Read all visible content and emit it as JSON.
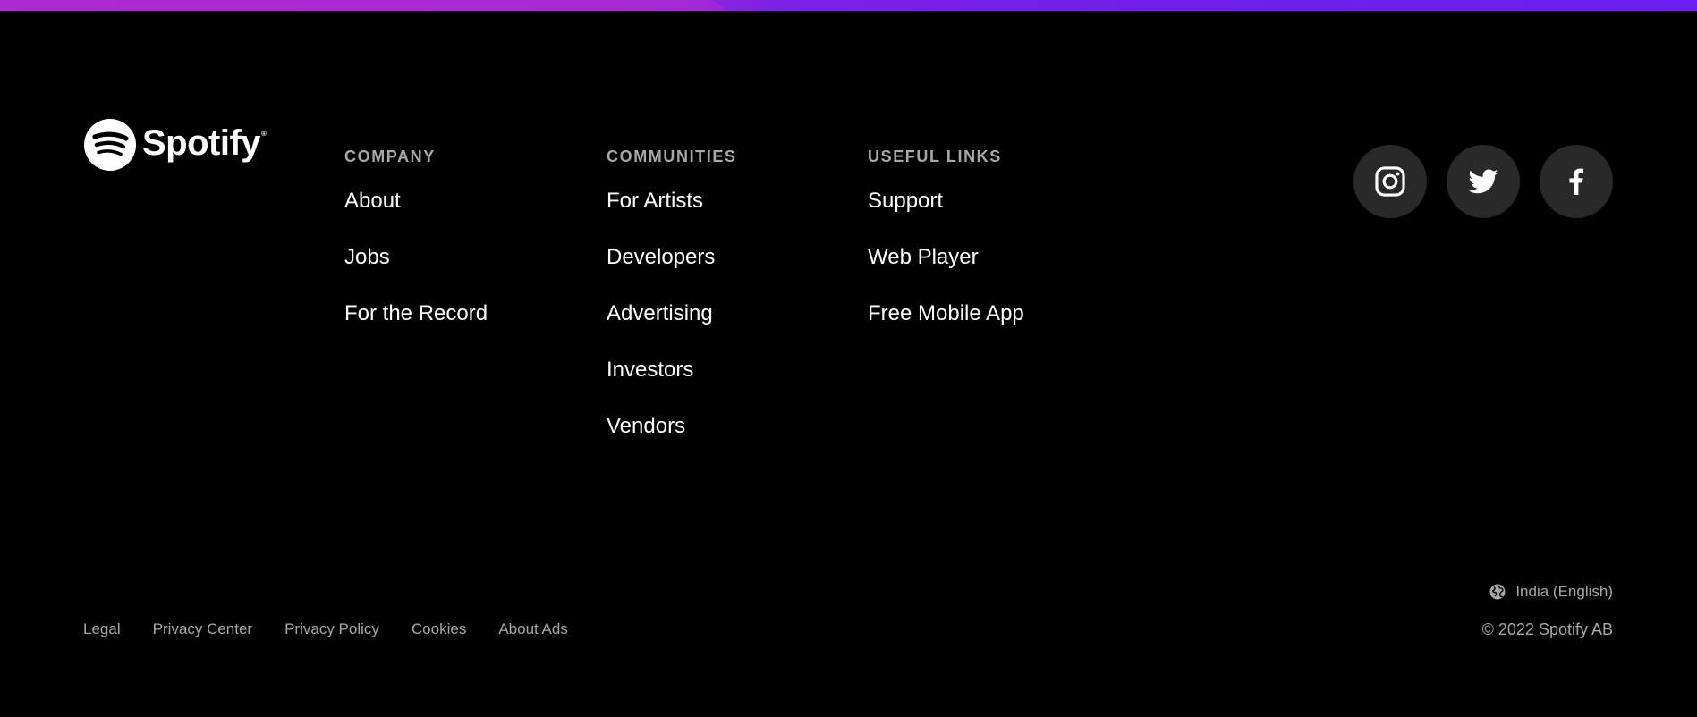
{
  "brand": {
    "name": "Spotify",
    "registered_mark": "®",
    "accent_gradient": [
      "#a82ad0",
      "#6c1ef0"
    ],
    "background": "#000000"
  },
  "footer": {
    "columns": [
      {
        "heading": "COMPANY",
        "links": [
          "About",
          "Jobs",
          "For the Record"
        ]
      },
      {
        "heading": "COMMUNITIES",
        "links": [
          "For Artists",
          "Developers",
          "Advertising",
          "Investors",
          "Vendors"
        ]
      },
      {
        "heading": "USEFUL LINKS",
        "links": [
          "Support",
          "Web Player",
          "Free Mobile App"
        ]
      }
    ],
    "social": [
      {
        "icon": "instagram-icon"
      },
      {
        "icon": "twitter-icon"
      },
      {
        "icon": "facebook-icon"
      }
    ],
    "locale": {
      "icon": "globe-icon",
      "label": "India (English)"
    },
    "legal_links": [
      "Legal",
      "Privacy Center",
      "Privacy Policy",
      "Cookies",
      "About Ads"
    ],
    "copyright": "© 2022 Spotify AB"
  }
}
